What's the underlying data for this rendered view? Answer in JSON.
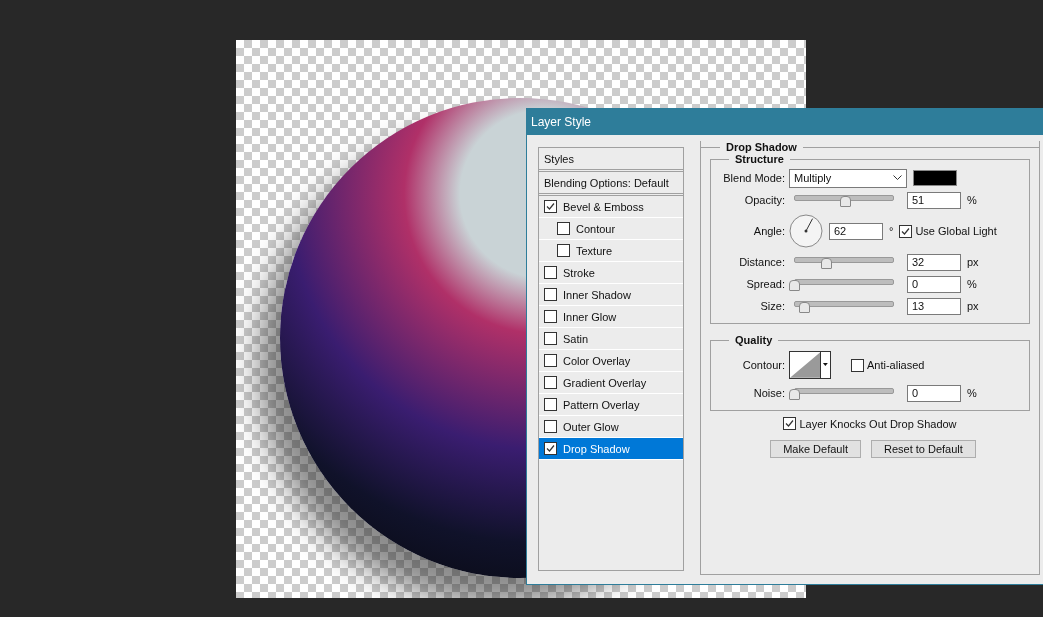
{
  "window": {
    "title": "Layer Style"
  },
  "styles_list": [
    {
      "label": "Styles",
      "kind": "header",
      "selected": false
    },
    {
      "label": "Blending Options: Default",
      "kind": "header",
      "selected": false
    },
    {
      "label": "Bevel & Emboss",
      "kind": "effect",
      "checked": true,
      "selected": false,
      "children": [
        {
          "label": "Contour",
          "kind": "effect",
          "checked": false,
          "selected": false
        },
        {
          "label": "Texture",
          "kind": "effect",
          "checked": false,
          "selected": false
        }
      ]
    },
    {
      "label": "Stroke",
      "kind": "effect",
      "checked": false,
      "selected": false
    },
    {
      "label": "Inner Shadow",
      "kind": "effect",
      "checked": false,
      "selected": false
    },
    {
      "label": "Inner Glow",
      "kind": "effect",
      "checked": false,
      "selected": false
    },
    {
      "label": "Satin",
      "kind": "effect",
      "checked": false,
      "selected": false
    },
    {
      "label": "Color Overlay",
      "kind": "effect",
      "checked": false,
      "selected": false
    },
    {
      "label": "Gradient Overlay",
      "kind": "effect",
      "checked": false,
      "selected": false
    },
    {
      "label": "Pattern Overlay",
      "kind": "effect",
      "checked": false,
      "selected": false
    },
    {
      "label": "Outer Glow",
      "kind": "effect",
      "checked": false,
      "selected": false
    },
    {
      "label": "Drop Shadow",
      "kind": "effect",
      "checked": true,
      "selected": true
    }
  ],
  "panel": {
    "title": "Drop Shadow",
    "structure": {
      "title": "Structure",
      "rows": [
        {
          "kind": "select",
          "label": "Blend Mode:",
          "value": "Multiply"
        },
        {
          "kind": "slider",
          "label": "Opacity:",
          "value": "51",
          "unit": "%",
          "level": 0.51
        },
        {
          "kind": "angle",
          "label": "Angle:",
          "value": "62",
          "unit": "°",
          "option": {
            "label": "Use Global Light",
            "checked": true
          }
        },
        {
          "kind": "slider",
          "label": "Distance:",
          "value": "32",
          "unit": "px",
          "level": 0.32
        },
        {
          "kind": "slider",
          "label": "Spread:",
          "value": "0",
          "unit": "%",
          "level": 0
        },
        {
          "kind": "slider",
          "label": "Size:",
          "value": "13",
          "unit": "px",
          "level": 0.1
        }
      ]
    },
    "quality": {
      "title": "Quality",
      "rows": [
        {
          "kind": "contour",
          "label": "Contour:",
          "option": {
            "label": "Anti-aliased",
            "checked": false
          }
        },
        {
          "kind": "slider",
          "label": "Noise:",
          "value": "0",
          "unit": "%",
          "level": 0
        }
      ]
    },
    "knockout": {
      "label": "Layer Knocks Out Drop Shadow",
      "checked": true
    },
    "buttons": [
      "Make Default",
      "Reset to Default"
    ]
  }
}
